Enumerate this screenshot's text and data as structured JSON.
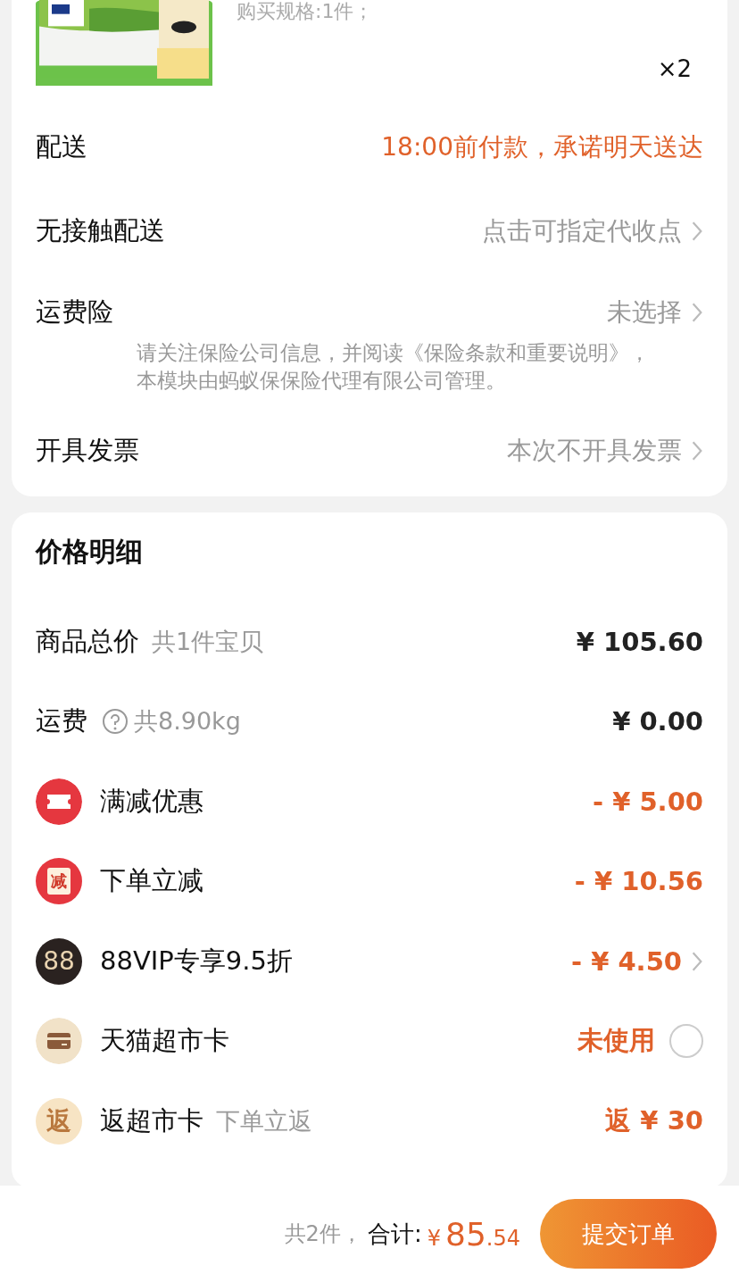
{
  "product": {
    "spec": "购买规格:1件；",
    "quantity": "×2"
  },
  "delivery_rows": [
    {
      "kind": "value",
      "label": "配送",
      "value": "18:00前付款，承诺明天送达",
      "accent": true
    },
    {
      "kind": "value",
      "label": "无接触配送",
      "value": "点击可指定代收点",
      "accent": false,
      "chevron": true
    },
    {
      "kind": "note",
      "label": "运费险",
      "value": "未选择",
      "accent": false,
      "chevron": true,
      "note": "请关注保险公司信息，并阅读《保险条款和重要说明》，本模块由蚂蚁保保险代理有限公司管理。"
    },
    {
      "kind": "value",
      "label": "开具发票",
      "value": "本次不开具发票",
      "accent": false,
      "chevron": true
    }
  ],
  "price_detail": {
    "title": "价格明细",
    "rows": [
      {
        "kind": "plain",
        "label": "商品总价",
        "sub": "共1件宝贝",
        "amount": "¥ 105.60",
        "accent": false
      },
      {
        "kind": "help",
        "label": "运费",
        "sub": "共8.90kg",
        "amount": "¥ 0.00",
        "accent": false
      },
      {
        "kind": "coupon",
        "label": "满减优惠",
        "amount": "- ¥ 5.00",
        "accent": true
      },
      {
        "kind": "discount",
        "icon_text": "减",
        "label": "下单立减",
        "amount": "- ¥ 10.56",
        "accent": true
      },
      {
        "kind": "vip",
        "icon_text": "88",
        "label": "88VIP专享9.5折",
        "amount": "- ¥ 4.50",
        "accent": true,
        "chevron": true
      },
      {
        "kind": "card",
        "label": "天猫超市卡",
        "amount": "未使用",
        "accent": true,
        "checked": false
      },
      {
        "kind": "rebate",
        "icon_text": "返",
        "label": "返超市卡",
        "sub": "下单立返",
        "amount": "返 ¥ 30",
        "accent": true
      }
    ]
  },
  "footer": {
    "count": "共2件，",
    "total_label": "合计:",
    "currency": "¥",
    "total_int": "85",
    "total_dec": ".54",
    "submit": "提交订单"
  }
}
